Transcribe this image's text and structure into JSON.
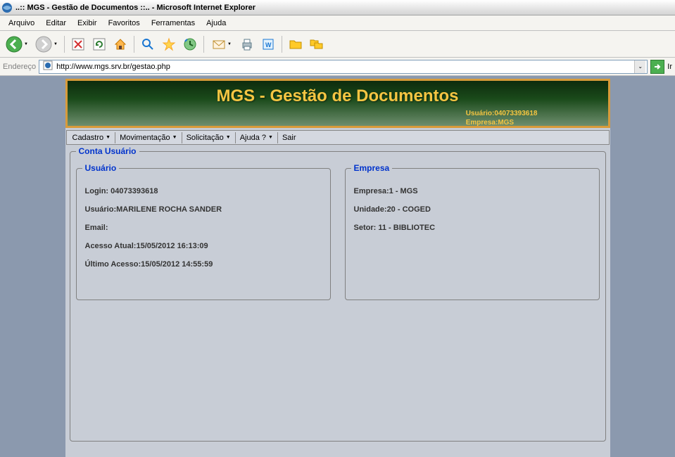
{
  "window": {
    "title": "..:: MGS - Gestão de Documentos ::.. - Microsoft Internet Explorer"
  },
  "browser_menu": {
    "arquivo": "Arquivo",
    "editar": "Editar",
    "exibir": "Exibir",
    "favoritos": "Favoritos",
    "ferramentas": "Ferramentas",
    "ajuda": "Ajuda"
  },
  "addressbar": {
    "label": "Endereço",
    "url": "http://www.mgs.srv.br/gestao.php",
    "go_label": "Ir"
  },
  "banner": {
    "title": "MGS - Gestão de Documentos",
    "usuario_label": "Usuário:",
    "usuario_value": "04073393618",
    "empresa_label": "Empresa:",
    "empresa_value": "MGS"
  },
  "app_menu": {
    "cadastro": "Cadastro",
    "movimentacao": "Movimentação",
    "solicitacao": "Solicitação",
    "ajuda": "Ajuda ?",
    "sair": "Sair"
  },
  "account": {
    "outer_legend": "Conta Usuário",
    "user_legend": "Usuário",
    "company_legend": "Empresa",
    "user": {
      "login_label": "Login: ",
      "login_value": "04073393618",
      "usuario_label": "Usuário:",
      "usuario_value": "MARILENE ROCHA SANDER",
      "email_label": "Email:",
      "email_value": "",
      "acesso_atual_label": "Acesso Atual:",
      "acesso_atual_value": "15/05/2012 16:13:09",
      "ultimo_acesso_label": "Último Acesso:",
      "ultimo_acesso_value": "15/05/2012 14:55:59"
    },
    "company": {
      "empresa_label": "Empresa:",
      "empresa_value": "1 - MGS",
      "unidade_label": "Unidade:",
      "unidade_value": "20 - COGED",
      "setor_label": "Setor: ",
      "setor_value": "11 - BIBLIOTEC"
    }
  }
}
